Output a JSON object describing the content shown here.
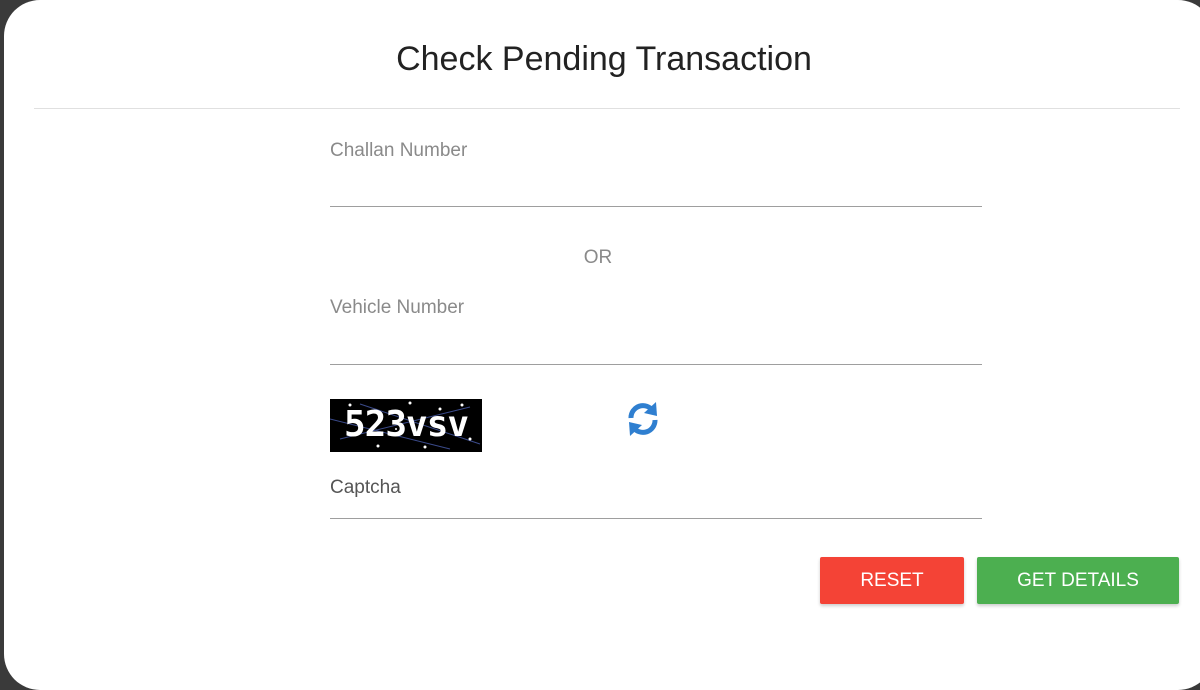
{
  "header": {
    "title": "Check Pending Transaction"
  },
  "form": {
    "challan_label": "Challan Number",
    "challan_value": "",
    "or_text": "OR",
    "vehicle_label": "Vehicle Number",
    "vehicle_value": "",
    "captcha_image_text": "523vsv",
    "captcha_label": "Captcha",
    "captcha_value": "",
    "refresh_icon": "refresh-icon"
  },
  "actions": {
    "reset_label": "RESET",
    "get_details_label": "GET DETAILS"
  },
  "colors": {
    "reset": "#f44336",
    "get_details": "#4caf50",
    "refresh_icon": "#2f7fd0"
  }
}
